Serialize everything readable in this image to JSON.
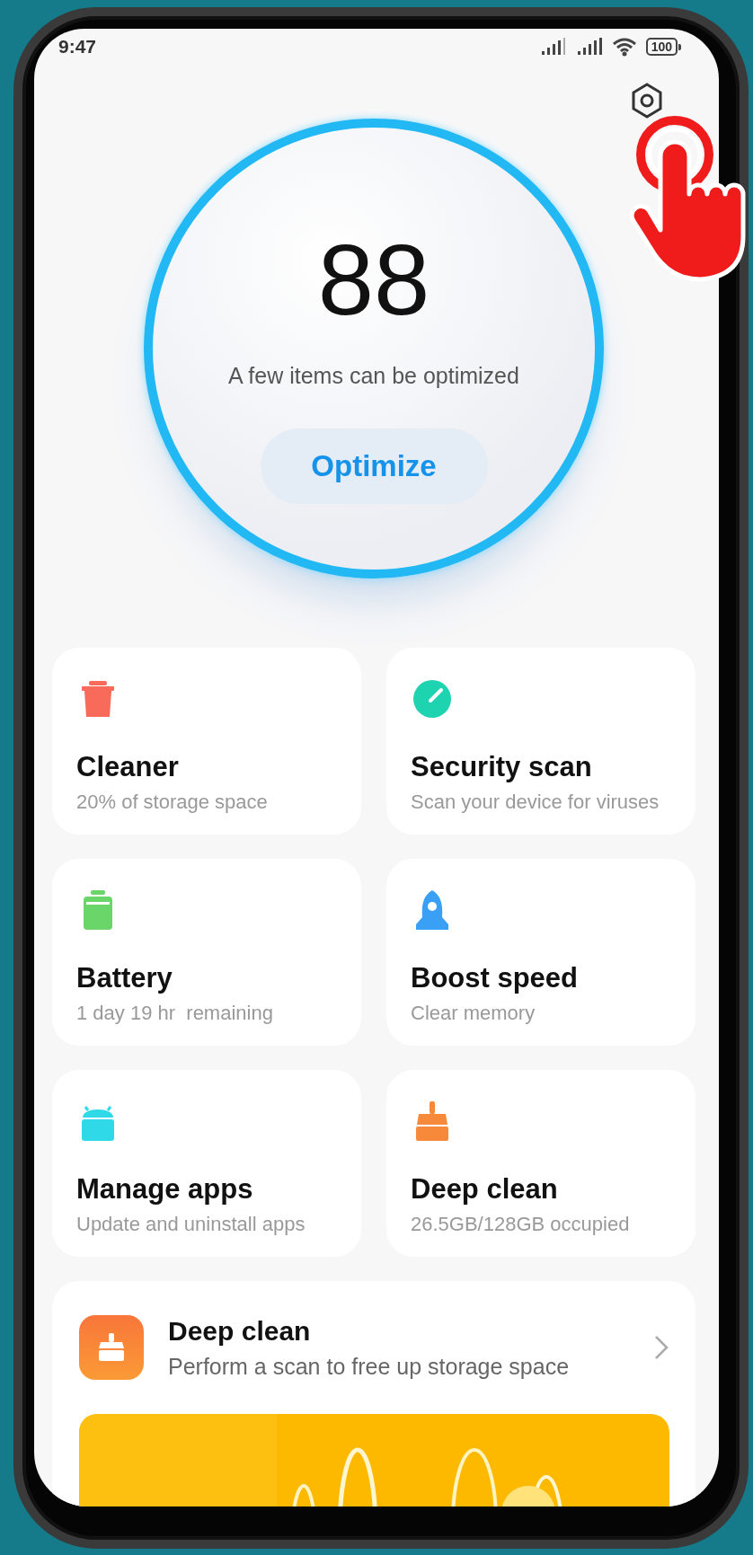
{
  "status_bar": {
    "time": "9:47",
    "battery": "100"
  },
  "score": {
    "value": "88",
    "caption": "A few items can be optimized",
    "button": "Optimize"
  },
  "tiles": [
    {
      "kind": "trash",
      "title": "Cleaner",
      "subtitle": "20% of storage space",
      "color": "#f86b5a"
    },
    {
      "kind": "gauge",
      "title": "Security scan",
      "subtitle": "Scan your device for viruses",
      "color": "#1ed3b0"
    },
    {
      "kind": "battery",
      "title": "Battery",
      "subtitle": "1 day 19 hr  remaining",
      "color": "#6ad66a"
    },
    {
      "kind": "rocket",
      "title": "Boost speed",
      "subtitle": "Clear memory",
      "color": "#3aa0f5"
    },
    {
      "kind": "android",
      "title": "Manage apps",
      "subtitle": "Update and uninstall apps",
      "color": "#30d9e8"
    },
    {
      "kind": "broom",
      "title": "Deep clean",
      "subtitle": "26.5GB/128GB occupied",
      "color": "#f68a3a"
    }
  ],
  "feature_card": {
    "title": "Deep clean",
    "subtitle": "Perform a scan to free up storage space"
  }
}
